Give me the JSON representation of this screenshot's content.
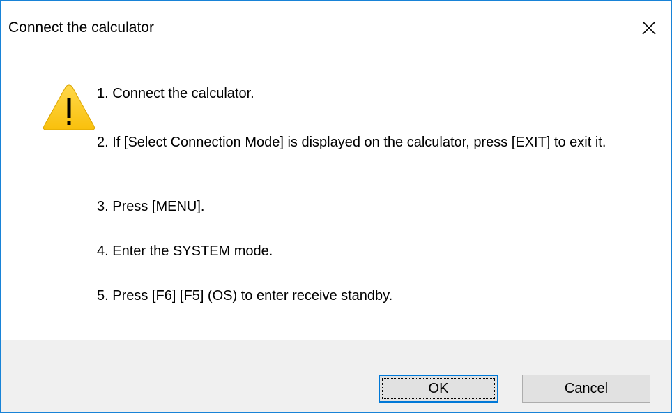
{
  "window": {
    "title": "Connect the calculator",
    "close_icon": "close-icon"
  },
  "message": {
    "icon": "warning-icon",
    "icon_color": "#FDCB0D",
    "lines": [
      "1. Connect the calculator.",
      "2. If [Select Connection Mode] is displayed on the calculator, press [EXIT] to exit it.",
      "3. Press [MENU].",
      "4. Enter the SYSTEM mode.",
      "5. Press [F6] [F5] (OS) to enter receive standby."
    ]
  },
  "buttons": {
    "ok_label": "OK",
    "cancel_label": "Cancel"
  },
  "colors": {
    "window_border": "#1883D7",
    "footer_background": "#F0F0F0",
    "default_button_border": "#0078D7"
  }
}
